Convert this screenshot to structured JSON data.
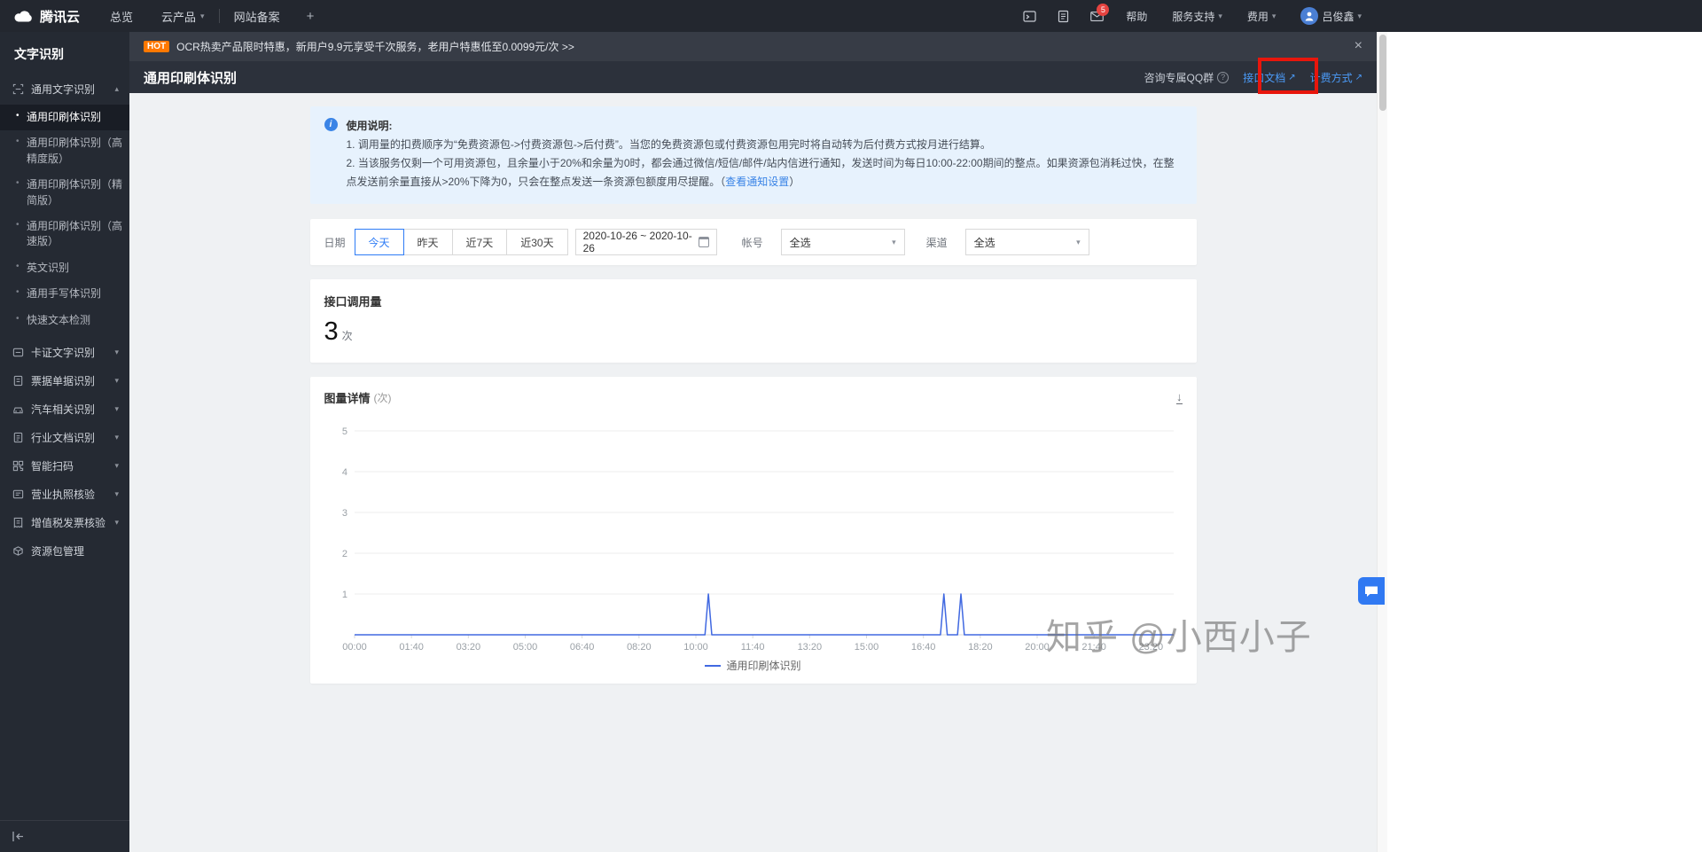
{
  "topnav": {
    "brand": "腾讯云",
    "overview": "总览",
    "products": "云产品",
    "beian": "网站备案",
    "add_tab": "+",
    "mail_badge": "5",
    "help": "帮助",
    "support": "服务支持",
    "billing": "费用",
    "user": "吕俊鑫"
  },
  "icons": {
    "caret_down": "▾",
    "caret_up": "▴",
    "close": "×",
    "download": "↓",
    "external": "↗",
    "info": "i",
    "qmark": "?"
  },
  "sidebar": {
    "title": "文字识别",
    "group1": {
      "label": "通用文字识别"
    },
    "children": [
      "通用印刷体识别",
      "通用印刷体识别（高精度版）",
      "通用印刷体识别（精简版）",
      "通用印刷体识别（高速版）",
      "英文识别",
      "通用手写体识别",
      "快速文本检测"
    ],
    "groups": [
      "卡证文字识别",
      "票据单据识别",
      "汽车相关识别",
      "行业文档识别",
      "智能扫码",
      "营业执照核验",
      "增值税发票核验",
      "资源包管理"
    ]
  },
  "banner": {
    "tag": "HOT",
    "text": "OCR热卖产品限时特惠，新用户9.9元享受千次服务，老用户特惠低至0.0099元/次 >>"
  },
  "header": {
    "title": "通用印刷体识别",
    "qq": "咨询专属QQ群",
    "doc_link": "接口文档",
    "billing_link": "计费方式"
  },
  "notice": {
    "title": "使用说明:",
    "line1": "1. 调用量的扣费顺序为“免费资源包->付费资源包->后付费”。当您的免费资源包或付费资源包用完时将自动转为后付费方式按月进行结算。",
    "line2": "2. 当该服务仅剩一个可用资源包，且余量小于20%和余量为0时，都会通过微信/短信/邮件/站内信进行通知，发送时间为每日10:00-22:00期间的整点。如果资源包消耗过快，在整点发送前余量直接从>20%下降为0，只会在整点发送一条资源包额度用尽提醒。（",
    "link": "查看通知设置",
    "line2_end": "）"
  },
  "filters": {
    "date_label": "日期",
    "ranges": [
      "今天",
      "昨天",
      "近7天",
      "近30天"
    ],
    "active_range": "今天",
    "date_value": "2020-10-26 ~ 2020-10-26",
    "account_label": "帐号",
    "account_value": "全选",
    "channel_label": "渠道",
    "channel_value": "全选"
  },
  "stats": {
    "title": "接口调用量",
    "value": "3",
    "unit": "次"
  },
  "chart": {
    "type": "line",
    "title": "图量详情",
    "unit": "(次)",
    "color": "#4169e1",
    "ylim": [
      0,
      5
    ],
    "y_ticks": [
      1,
      2,
      3,
      4,
      5
    ],
    "x_ticks": [
      "00:00",
      "01:40",
      "03:20",
      "05:00",
      "06:40",
      "08:20",
      "10:00",
      "11:40",
      "13:20",
      "15:00",
      "16:40",
      "18:20",
      "20:00",
      "21:40",
      "23:20"
    ],
    "x_tick_interval_minutes": 100,
    "total_minutes": 1440,
    "series": [
      {
        "name": "通用印刷体识别",
        "baseline": 0,
        "spikes": [
          {
            "minute": 622,
            "value": 1
          },
          {
            "minute": 1036,
            "value": 1
          },
          {
            "minute": 1066,
            "value": 1
          }
        ]
      }
    ]
  },
  "watermark": "知乎 @小西小子"
}
